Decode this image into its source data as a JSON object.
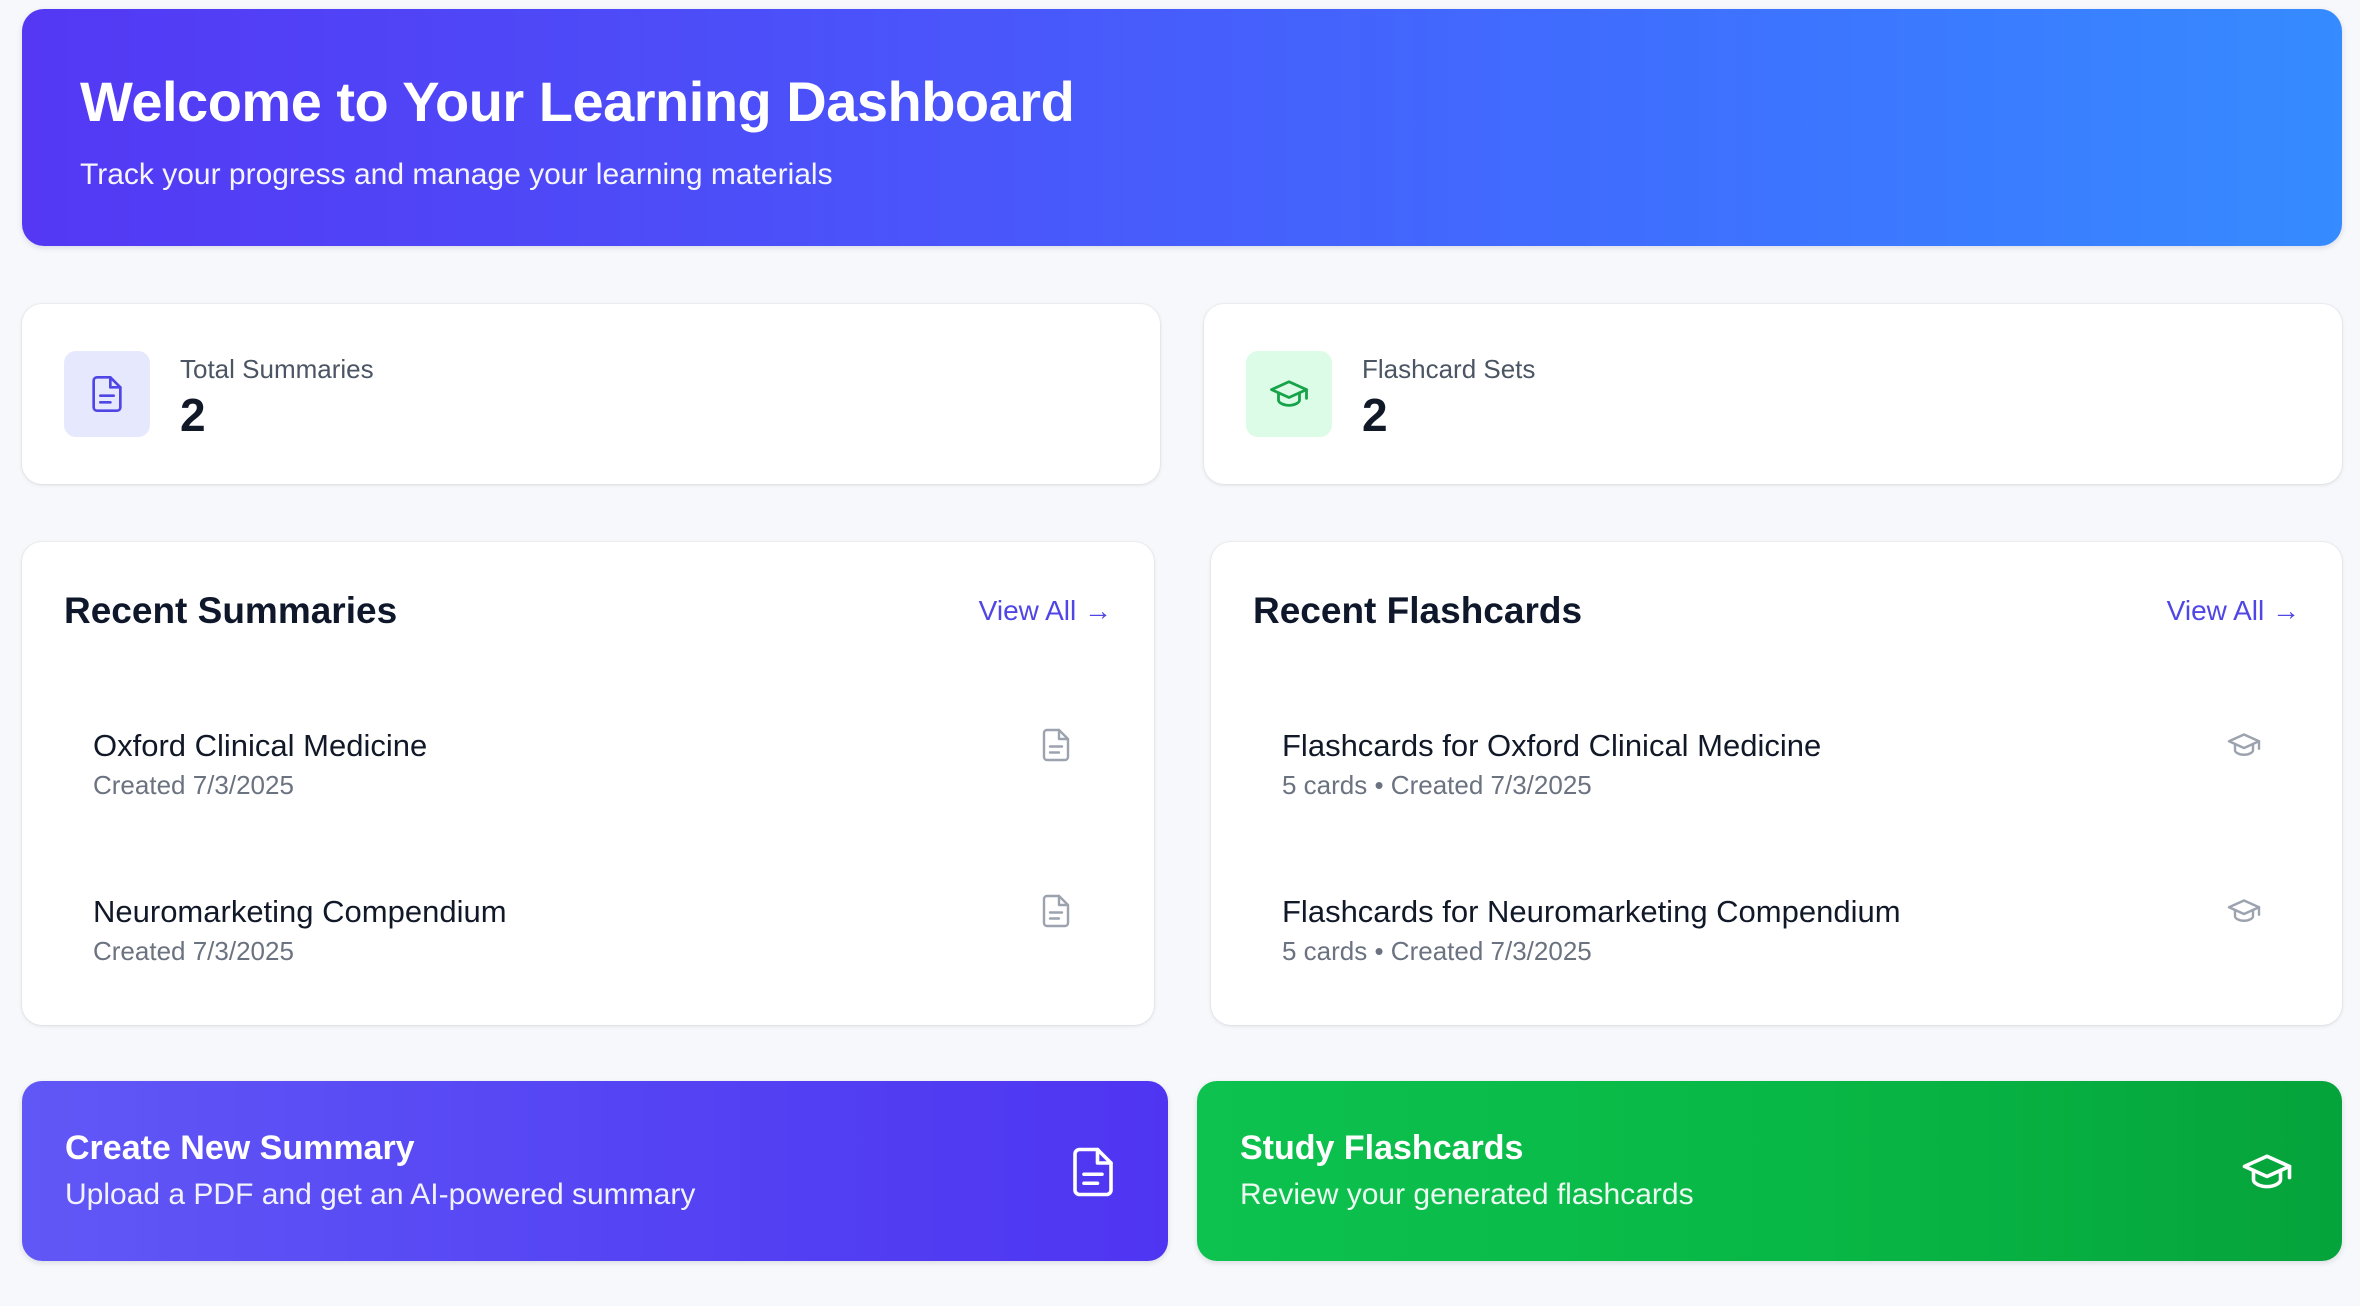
{
  "header": {
    "title": "Welcome to Your Learning Dashboard",
    "subtitle": "Track your progress and manage your learning materials"
  },
  "stats": [
    {
      "label": "Total Summaries",
      "value": "2",
      "icon": "document-icon",
      "accent": "#4f46e5",
      "bg": "#e6e8fd"
    },
    {
      "label": "Flashcard Sets",
      "value": "2",
      "icon": "graduation-cap-icon",
      "accent": "#16a34a",
      "bg": "#dcfce7"
    }
  ],
  "recent_summaries": {
    "title": "Recent Summaries",
    "view_all": "View All →",
    "items": [
      {
        "title": "Oxford Clinical Medicine",
        "meta": "Created 7/3/2025"
      },
      {
        "title": "Neuromarketing Compendium",
        "meta": "Created 7/3/2025"
      }
    ]
  },
  "recent_flashcards": {
    "title": "Recent Flashcards",
    "view_all": "View All →",
    "items": [
      {
        "title": "Flashcards for Oxford Clinical Medicine",
        "meta": "5 cards • Created 7/3/2025"
      },
      {
        "title": "Flashcards for Neuromarketing Compendium",
        "meta": "5 cards • Created 7/3/2025"
      }
    ]
  },
  "actions": {
    "create_summary": {
      "title": "Create New Summary",
      "subtitle": "Upload a PDF and get an AI-powered summary",
      "icon": "document-icon"
    },
    "study_flashcards": {
      "title": "Study Flashcards",
      "subtitle": "Review your generated flashcards",
      "icon": "graduation-cap-icon"
    }
  },
  "colors": {
    "primary": "#4f46e5",
    "success": "#16a34a",
    "hero_gradient_start": "#5438f4",
    "hero_gradient_end": "#368bff"
  }
}
